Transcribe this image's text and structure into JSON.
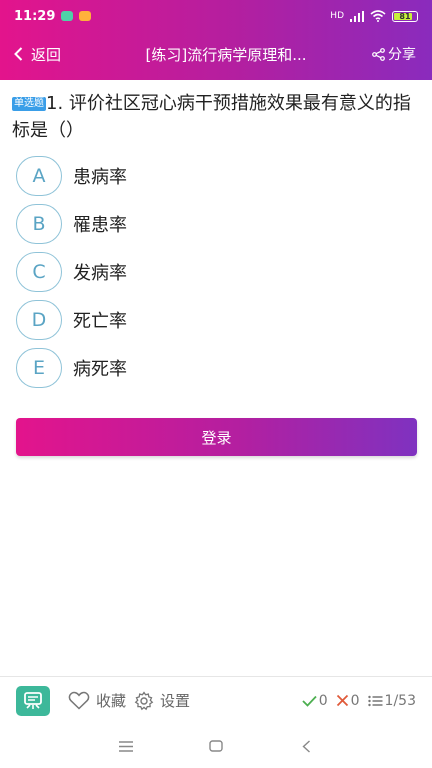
{
  "status_bar": {
    "time": "11:29",
    "signal_label": "HD",
    "battery_level": "81",
    "battery_fraction": 0.81
  },
  "header": {
    "back_label": "返回",
    "title": "[练习]流行病学原理和...",
    "share_label": "分享"
  },
  "question": {
    "type_tag": "单选题",
    "text": "1. 评价社区冠心病干预措施效果最有意义的指标是（）",
    "options": [
      {
        "letter": "A",
        "text": "患病率"
      },
      {
        "letter": "B",
        "text": "罹患率"
      },
      {
        "letter": "C",
        "text": "发病率"
      },
      {
        "letter": "D",
        "text": "死亡率"
      },
      {
        "letter": "E",
        "text": "病死率"
      }
    ]
  },
  "login_button": "登录",
  "bottom_bar": {
    "favorite_label": "收藏",
    "settings_label": "设置",
    "correct_count": "0",
    "wrong_count": "0",
    "progress": "1/53"
  },
  "colors": {
    "accent_start": "#e3148c",
    "accent_end": "#8a2bbd",
    "option_border": "#8fc3d8",
    "correct": "#4caf50",
    "wrong": "#e05a3a"
  }
}
